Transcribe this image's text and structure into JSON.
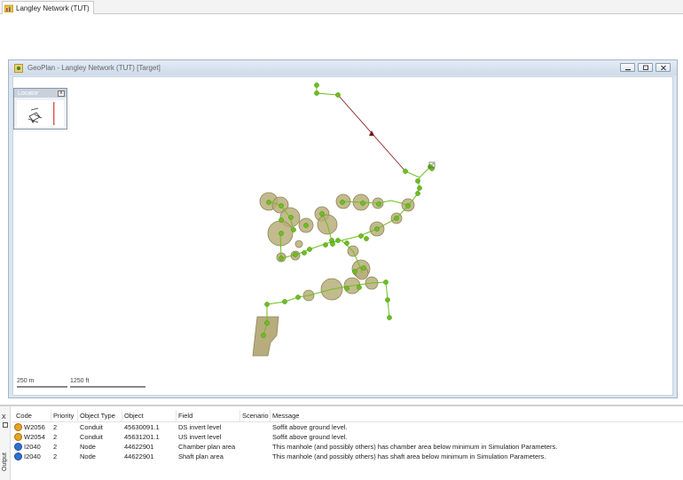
{
  "document_tab": {
    "label": "Langley Network (TUT)"
  },
  "geoplan": {
    "title": "GeoPlan - Langley Network (TUT) [Target]",
    "locator_label": "Locator",
    "locator_close": "x",
    "scale_metric": "250 m",
    "scale_imperial": "1250 ft",
    "colors": {
      "node": "#6cbf1e",
      "link": "#6cbf1e",
      "chamber_fill": "#b9ae7a",
      "chamber_stroke": "#8e8558",
      "trunk_link": "#8b2222",
      "subcatchment": "#b7ad7c"
    }
  },
  "output": {
    "panel_label": "Output",
    "close_label": "x",
    "columns": {
      "code": "Code",
      "priority": "Priority",
      "object_type": "Object Type",
      "object": "Object",
      "field": "Field",
      "scenario": "Scenario",
      "message": "Message"
    },
    "rows": [
      {
        "severity": "warning",
        "code": "W2056",
        "priority": "2",
        "object_type": "Conduit",
        "object": "45630091.1",
        "field": "DS invert level",
        "scenario": "",
        "message": "Soffit above ground level."
      },
      {
        "severity": "warning",
        "code": "W2054",
        "priority": "2",
        "object_type": "Conduit",
        "object": "45631201.1",
        "field": "US invert level",
        "scenario": "",
        "message": "Soffit above ground level."
      },
      {
        "severity": "info",
        "code": "I2040",
        "priority": "2",
        "object_type": "Node",
        "object": "44622901",
        "field": "Chamber plan area",
        "scenario": "",
        "message": "This manhole (and possibly others) has chamber area below minimum in Simulation Parameters."
      },
      {
        "severity": "info",
        "code": "I2040",
        "priority": "2",
        "object_type": "Node",
        "object": "44622901",
        "field": "Shaft plan area",
        "scenario": "",
        "message": "This manhole (and possibly others) has shaft area below minimum in Simulation Parameters."
      }
    ]
  }
}
